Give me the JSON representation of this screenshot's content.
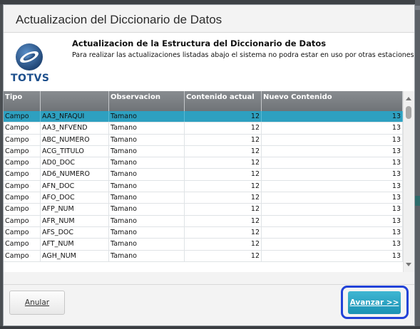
{
  "dialog": {
    "title": "Actualizacion del Diccionario de Datos"
  },
  "header": {
    "logo_text": "TOTVS",
    "title": "Actualizacion de la Estructura del Diccionario de Datos",
    "subtitle": "Para realizar las actualizaciones listadas abajo el sistema no podra estar en uso por otras estaciones"
  },
  "grid": {
    "columns": [
      "Tipo",
      "",
      "Observacion",
      "Contenido actual",
      "Nuevo Contenido"
    ],
    "rows": [
      {
        "tipo": "Campo",
        "campo": "AA3_NFAQUI",
        "obs": "Tamano",
        "actual": "12",
        "nuevo": "13",
        "selected": true
      },
      {
        "tipo": "Campo",
        "campo": "AA3_NFVEND",
        "obs": "Tamano",
        "actual": "12",
        "nuevo": "13"
      },
      {
        "tipo": "Campo",
        "campo": "ABC_NUMERO",
        "obs": "Tamano",
        "actual": "12",
        "nuevo": "13"
      },
      {
        "tipo": "Campo",
        "campo": "ACG_TITULO",
        "obs": "Tamano",
        "actual": "12",
        "nuevo": "13"
      },
      {
        "tipo": "Campo",
        "campo": "AD0_DOC",
        "obs": "Tamano",
        "actual": "12",
        "nuevo": "13"
      },
      {
        "tipo": "Campo",
        "campo": "AD6_NUMERO",
        "obs": "Tamano",
        "actual": "12",
        "nuevo": "13"
      },
      {
        "tipo": "Campo",
        "campo": "AFN_DOC",
        "obs": "Tamano",
        "actual": "12",
        "nuevo": "13"
      },
      {
        "tipo": "Campo",
        "campo": "AFO_DOC",
        "obs": "Tamano",
        "actual": "12",
        "nuevo": "13"
      },
      {
        "tipo": "Campo",
        "campo": "AFP_NUM",
        "obs": "Tamano",
        "actual": "12",
        "nuevo": "13"
      },
      {
        "tipo": "Campo",
        "campo": "AFR_NUM",
        "obs": "Tamano",
        "actual": "12",
        "nuevo": "13"
      },
      {
        "tipo": "Campo",
        "campo": "AFS_DOC",
        "obs": "Tamano",
        "actual": "12",
        "nuevo": "13"
      },
      {
        "tipo": "Campo",
        "campo": "AFT_NUM",
        "obs": "Tamano",
        "actual": "12",
        "nuevo": "13"
      },
      {
        "tipo": "Campo",
        "campo": "AGH_NUM",
        "obs": "Tamano",
        "actual": "12",
        "nuevo": "13"
      }
    ]
  },
  "buttons": {
    "cancel": "Anular",
    "next": "Avanzar >>"
  },
  "colors": {
    "selected_row": "#2ea0c0",
    "primary_button": "#1a92b4",
    "focus_ring": "#2242d8",
    "brand": "#1d4f8c"
  },
  "icons": {
    "logo": "totvs-logo-icon",
    "scroll_up": "arrow-up-icon",
    "scroll_down": "arrow-down-icon",
    "scroll_left": "arrow-left-icon",
    "scroll_right": "arrow-right-icon"
  }
}
